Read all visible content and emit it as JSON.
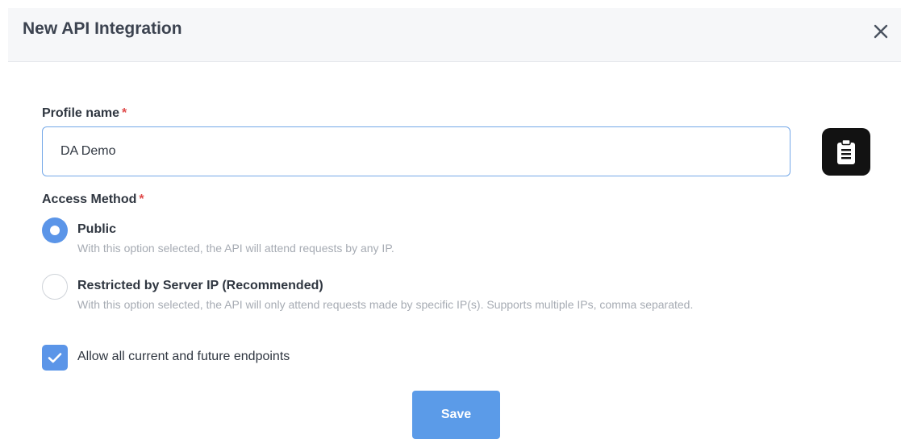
{
  "modal": {
    "title": "New API Integration",
    "close_icon": "close-icon"
  },
  "profile": {
    "label": "Profile name",
    "required_mark": "*",
    "value": "DA Demo",
    "paste_icon": "clipboard-icon"
  },
  "access": {
    "label": "Access Method",
    "required_mark": "*",
    "options": [
      {
        "title": "Public",
        "description": "With this option selected, the API will attend requests by any IP.",
        "selected": true
      },
      {
        "title": "Restricted by Server IP (Recommended)",
        "description": "With this option selected, the API will only attend requests made by specific IP(s). Supports multiple IPs, comma separated.",
        "selected": false
      }
    ]
  },
  "endpoints": {
    "label": "Allow all current and future endpoints",
    "checked": true
  },
  "actions": {
    "save_label": "Save"
  },
  "colors": {
    "accent": "#5b95e8",
    "required": "#e04b4b",
    "header_bg": "#f6f7f9"
  }
}
